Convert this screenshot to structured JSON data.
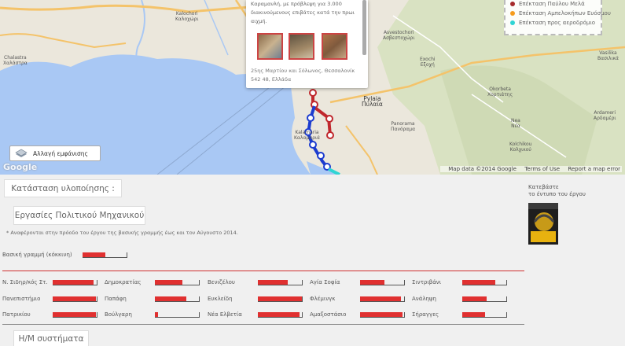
{
  "map": {
    "popup": {
      "text_line1": "Καραμανλή, με πρόβλεψη για 3.000",
      "text_line2": "διακινούμενους επιβάτες κατά την πρωι",
      "text_line3": "αιχμή.",
      "address_line1": "25ης Μαρτίου και Σόλωνος, Θεσσαλονίκ",
      "address_line2": "542 48, Ελλάδα"
    },
    "legend": [
      {
        "label": "Επέκταση Παύλου Μελά",
        "color": "#a52a2a"
      },
      {
        "label": "Επέκταση Αμπελοκήπων Ευόσμου",
        "color": "#f59b1c"
      },
      {
        "label": "Επέκταση προς αεροδρόμιο",
        "color": "#2fd4d4"
      }
    ],
    "towns": {
      "kalochori": "Kalochori\nΚαλοχώρι",
      "chalastra": "Chalastra\nΧαλάστρα",
      "pylaia": "Pylaia\nΠυλαία",
      "panorama": "Panorama\nΠανόραμα",
      "kalamaria": "Kalamaria\nΚαλαμαριά",
      "asvestochori": "Asvestochori\nΑσβεστοχώρι",
      "exochi": "Exochi\nΕξοχή",
      "chortiatis": "Chortiatis\nΧορτιάτης",
      "vasilika": "Vasilika\nΒασιλικά",
      "kouvardi": "Okorbeta\nΧορτιάτης",
      "thermi": "Ardameri\nΑρδαμέρι",
      "kolchiko": "Kolchikou\nΚολχικού",
      "peraia": "Nea\nΝέα"
    },
    "view_button": "Αλλαγή εμφάνισης",
    "google": "Google",
    "map_data": "Map data ©2014 Google",
    "terms": "Terms of Use",
    "report": "Report a map error"
  },
  "status": {
    "heading": "Κατάσταση υλοποίησης :",
    "civil_heading": "Εργασίες Πολιτικού Μηχανικού",
    "note": "* Αναφέρονται στην πρόοδο του έργου της βασικής γραμμής έως και τον Αύγουστο 2014.",
    "baseline_label": "Βασική γραμμή (κόκκινη)",
    "baseline_progress": 0.52,
    "stations": [
      {
        "name": "Ν. Σιδηρ/κός Στ.",
        "progress": 0.92
      },
      {
        "name": "Πανεπιστήμιο",
        "progress": 0.98
      },
      {
        "name": "Πατρικίου",
        "progress": 0.98
      },
      {
        "name": "Δημοκρατίας",
        "progress": 0.62
      },
      {
        "name": "Παπάφη",
        "progress": 0.72
      },
      {
        "name": "Βούλγαρη",
        "progress": 0.07
      },
      {
        "name": "Βενιζέλου",
        "progress": 0.68
      },
      {
        "name": "Ευκλείδη",
        "progress": 1.0
      },
      {
        "name": "Νέα Ελβετία",
        "progress": 0.95
      },
      {
        "name": "Αγία Σοφία",
        "progress": 0.55
      },
      {
        "name": "Φλέμινγκ",
        "progress": 0.92
      },
      {
        "name": "Αμαξοστάσιο",
        "progress": 0.97
      },
      {
        "name": "Σιντριβάνι",
        "progress": 0.75
      },
      {
        "name": "Ανάληψη",
        "progress": 0.55
      },
      {
        "name": "Σήραγγες",
        "progress": 0.52
      }
    ],
    "em_heading": "Η/Μ συστήματα"
  },
  "booklet": {
    "line1": "Κατεβάστε",
    "line2": "το έντυπο του έργου"
  }
}
